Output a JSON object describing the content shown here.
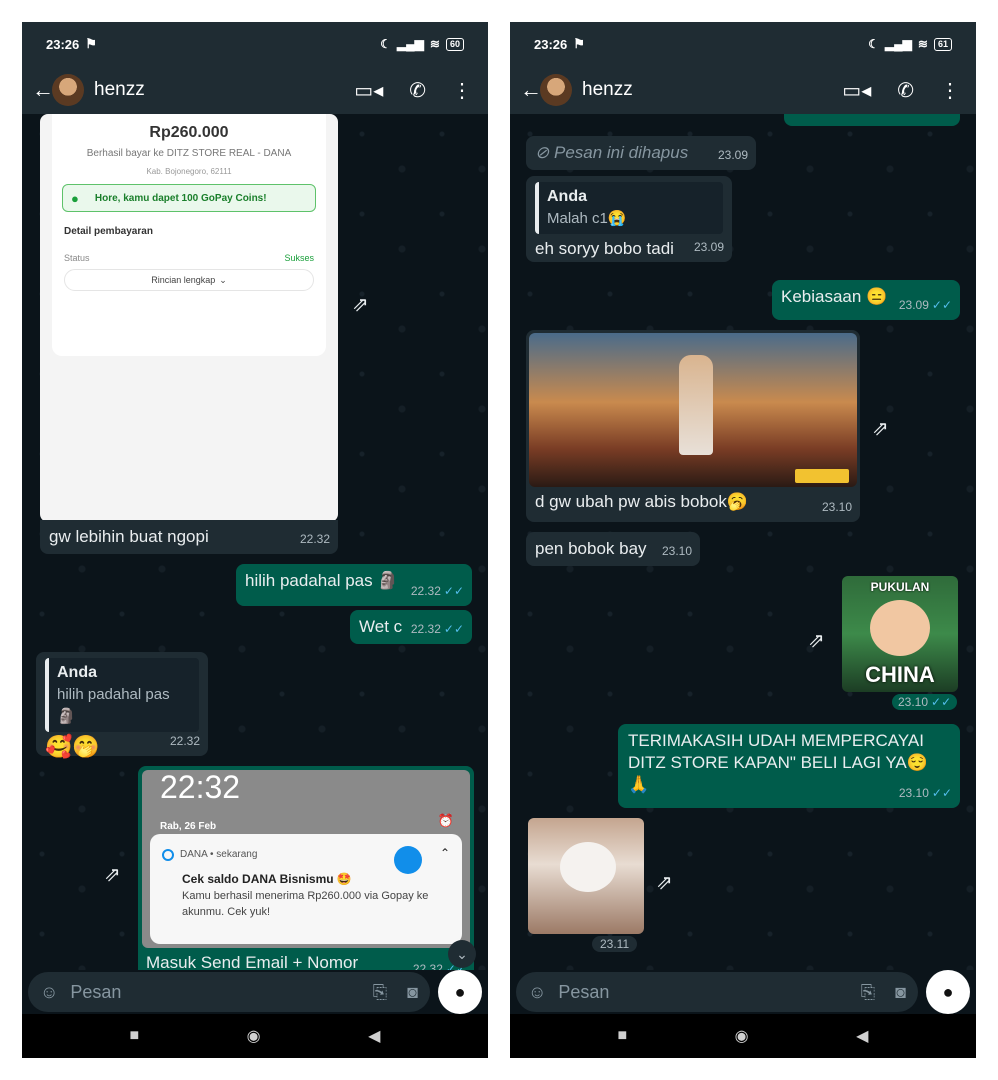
{
  "left": {
    "status": {
      "time": "23:26",
      "battery": "60"
    },
    "header": {
      "contact": "henzz"
    },
    "receipt": {
      "amount": "Rp260.000",
      "paid_to": "Berhasil bayar ke DITZ STORE REAL - DANA",
      "location": "Kab. Bojonegoro, 62111",
      "coins": "Hore, kamu dapet 100 GoPay Coins!",
      "detail_title": "Detail pembayaran",
      "status_label": "Status",
      "status_value": "Sukses",
      "details_button": "Rincian lengkap"
    },
    "msg1": {
      "text": "gw lebihin buat ngopi",
      "time": "22.32"
    },
    "msg2": {
      "text": "hilih padahal pas 🗿",
      "time": "22.32"
    },
    "msg3": {
      "text": "Wet c",
      "time": "22.32"
    },
    "msg4": {
      "quote_name": "Anda",
      "quote_text": "hilih padahal pas 🗿",
      "text": "🥰🤭",
      "time": "22.32"
    },
    "notif": {
      "clock": "22:32",
      "date": "Rab, 26 Feb",
      "app": "DANA • sekarang",
      "title": "Cek saldo DANA Bisnismu 🤩",
      "body": "Kamu berhasil menerima Rp260.000 via Gopay ke akunmu. Cek yuk!"
    },
    "msg5": {
      "text": "Masuk Send Email + Nomor",
      "time": "22.32"
    },
    "composer_placeholder": "Pesan"
  },
  "right": {
    "status": {
      "time": "23:26",
      "battery": "61"
    },
    "header": {
      "contact": "henzz"
    },
    "deleted": {
      "text": "Pesan ini dihapus",
      "time": "23.09"
    },
    "msg1": {
      "quote_name": "Anda",
      "quote_text": "Malah c1😭",
      "text": "eh soryy bobo tadi",
      "time": "23.09"
    },
    "msg2": {
      "text": "Kebiasaan 😑",
      "time": "23.09"
    },
    "msg3": {
      "text": "d gw ubah pw abis bobok🥱",
      "time": "23.10"
    },
    "msg4": {
      "text": "pen bobok bay",
      "time": "23.10"
    },
    "sticker1": {
      "top": "PUKULAN",
      "bottom": "CHINA",
      "time": "23.10"
    },
    "msg5": {
      "text": "TERIMAKASIH UDAH MEMPERCAYAI DITZ STORE KAPAN\" BELI LAGI YA😌🙏",
      "time": "23.10"
    },
    "sticker2": {
      "time": "23.11"
    },
    "composer_placeholder": "Pesan"
  },
  "colors": {
    "incoming": "#1f2c33",
    "outgoing": "#005c4b",
    "ticks": "#53bdeb"
  }
}
